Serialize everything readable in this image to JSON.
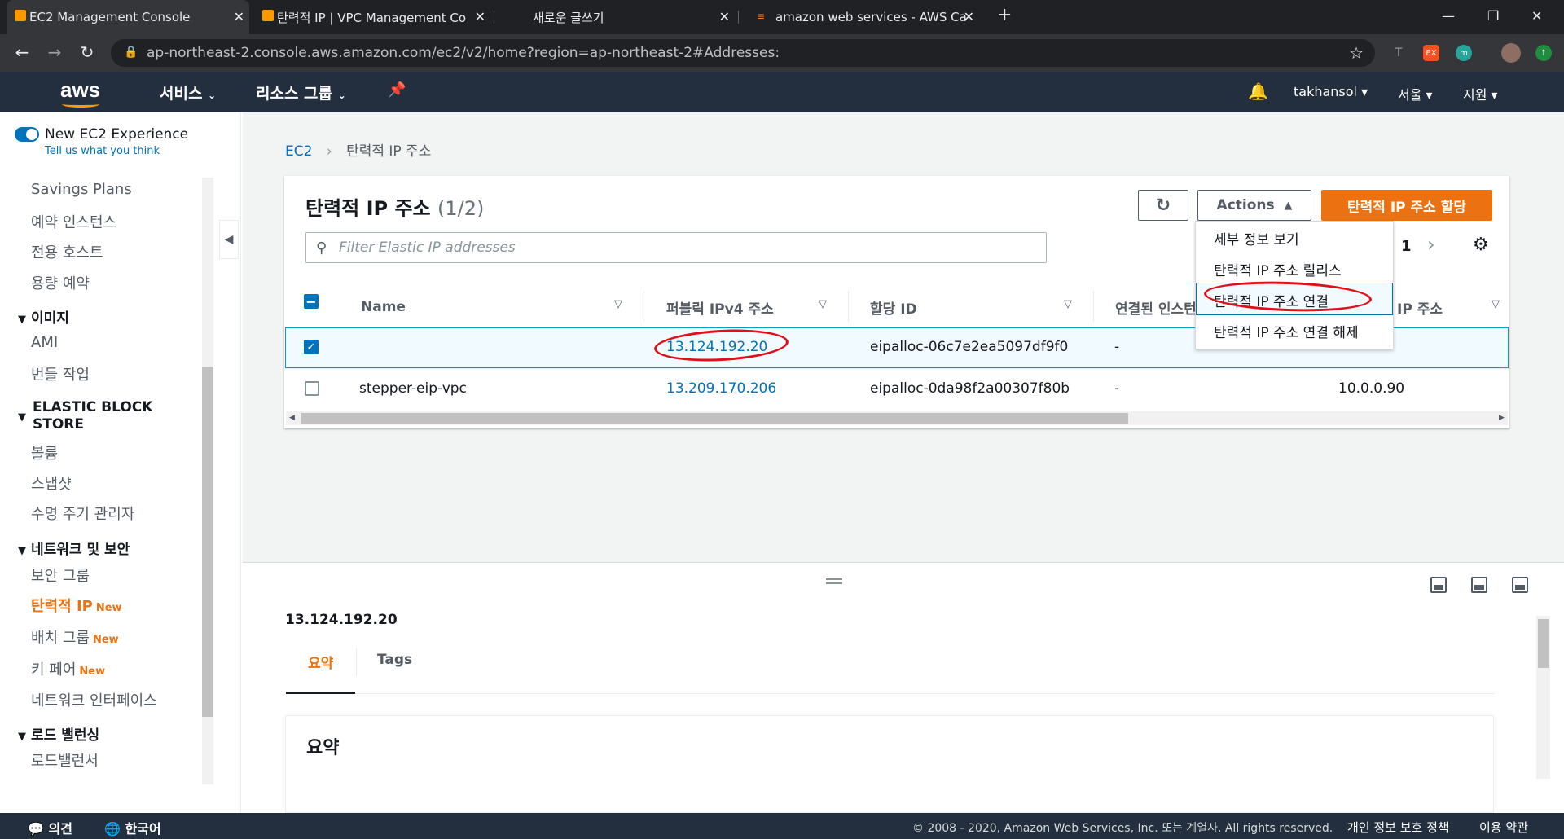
{
  "browser": {
    "tabs": [
      {
        "title": "EC2 Management Console",
        "active": true
      },
      {
        "title": "탄력적 IP | VPC Management Co"
      },
      {
        "title": "새로운 글쓰기"
      },
      {
        "title": "amazon web services - AWS Ca"
      }
    ],
    "url": "ap-northeast-2.console.aws.amazon.com/ec2/v2/home?region=ap-northeast-2#Addresses:",
    "new_tab": "+",
    "ext_ex": "EX",
    "ext_m": "m"
  },
  "aws_nav": {
    "logo": "aws",
    "services": "서비스",
    "resource_groups": "리소스 그룹",
    "user": "takhansol",
    "region": "서울",
    "support": "지원"
  },
  "sidebar": {
    "new_experience": "New EC2 Experience",
    "feedback": "Tell us what you think",
    "items": [
      {
        "label": "Savings Plans"
      },
      {
        "label": "예약 인스턴스"
      },
      {
        "label": "전용 호스트"
      },
      {
        "label": "용량 예약"
      }
    ],
    "sections": [
      {
        "title": "이미지",
        "items": [
          "AMI",
          "번들 작업"
        ]
      },
      {
        "title": "ELASTIC BLOCK STORE",
        "items": [
          "볼륨",
          "스냅샷",
          "수명 주기 관리자"
        ]
      },
      {
        "title": "네트워크 및 보안",
        "items": [
          "보안 그룹",
          "탄력적 IP",
          "배치 그룹",
          "키 페어",
          "네트워크 인터페이스"
        ]
      },
      {
        "title": "로드 밸런싱",
        "items": [
          "로드밸런서"
        ]
      }
    ],
    "new_badge": "New"
  },
  "breadcrumb": {
    "root": "EC2",
    "current": "탄력적 IP 주소"
  },
  "table": {
    "title": "탄력적 IP 주소",
    "count": "(1/2)",
    "search_placeholder": "Filter Elastic IP addresses",
    "actions_label": "Actions",
    "allocate_label": "탄력적 IP 주소 할당",
    "page": "1",
    "columns": [
      "Name",
      "퍼블릭 IPv4 주소",
      "할당 ID",
      "연결된 인스턴",
      "프라이빗 IP 주소"
    ],
    "col5_visible": "IP 주소",
    "rows": [
      {
        "name": "",
        "ip": "13.124.192.20",
        "alloc": "eipalloc-06c7e2ea5097df9f0",
        "instance": "-",
        "private_ip": "",
        "selected": true
      },
      {
        "name": "stepper-eip-vpc",
        "ip": "13.209.170.206",
        "alloc": "eipalloc-0da98f2a00307f80b",
        "instance": "-",
        "private_ip": "10.0.0.90",
        "selected": false
      }
    ]
  },
  "actions_menu": [
    "세부 정보 보기",
    "탄력적 IP 주소 릴리스",
    "탄력적 IP 주소 연결",
    "탄력적 IP 주소 연결 해제"
  ],
  "details": {
    "ip": "13.124.192.20",
    "tabs": [
      "요약",
      "Tags"
    ],
    "section_title": "요약"
  },
  "footer": {
    "feedback": "의견",
    "language": "한국어",
    "copyright": "© 2008 - 2020, Amazon Web Services, Inc. 또는 계열사. All rights reserved.",
    "privacy": "개인 정보 보호 정책",
    "terms": "이용 약관"
  },
  "colors": {
    "accent": "#ec7211",
    "link": "#0073bb",
    "nav": "#232f3e",
    "annotation": "#e0101a"
  }
}
